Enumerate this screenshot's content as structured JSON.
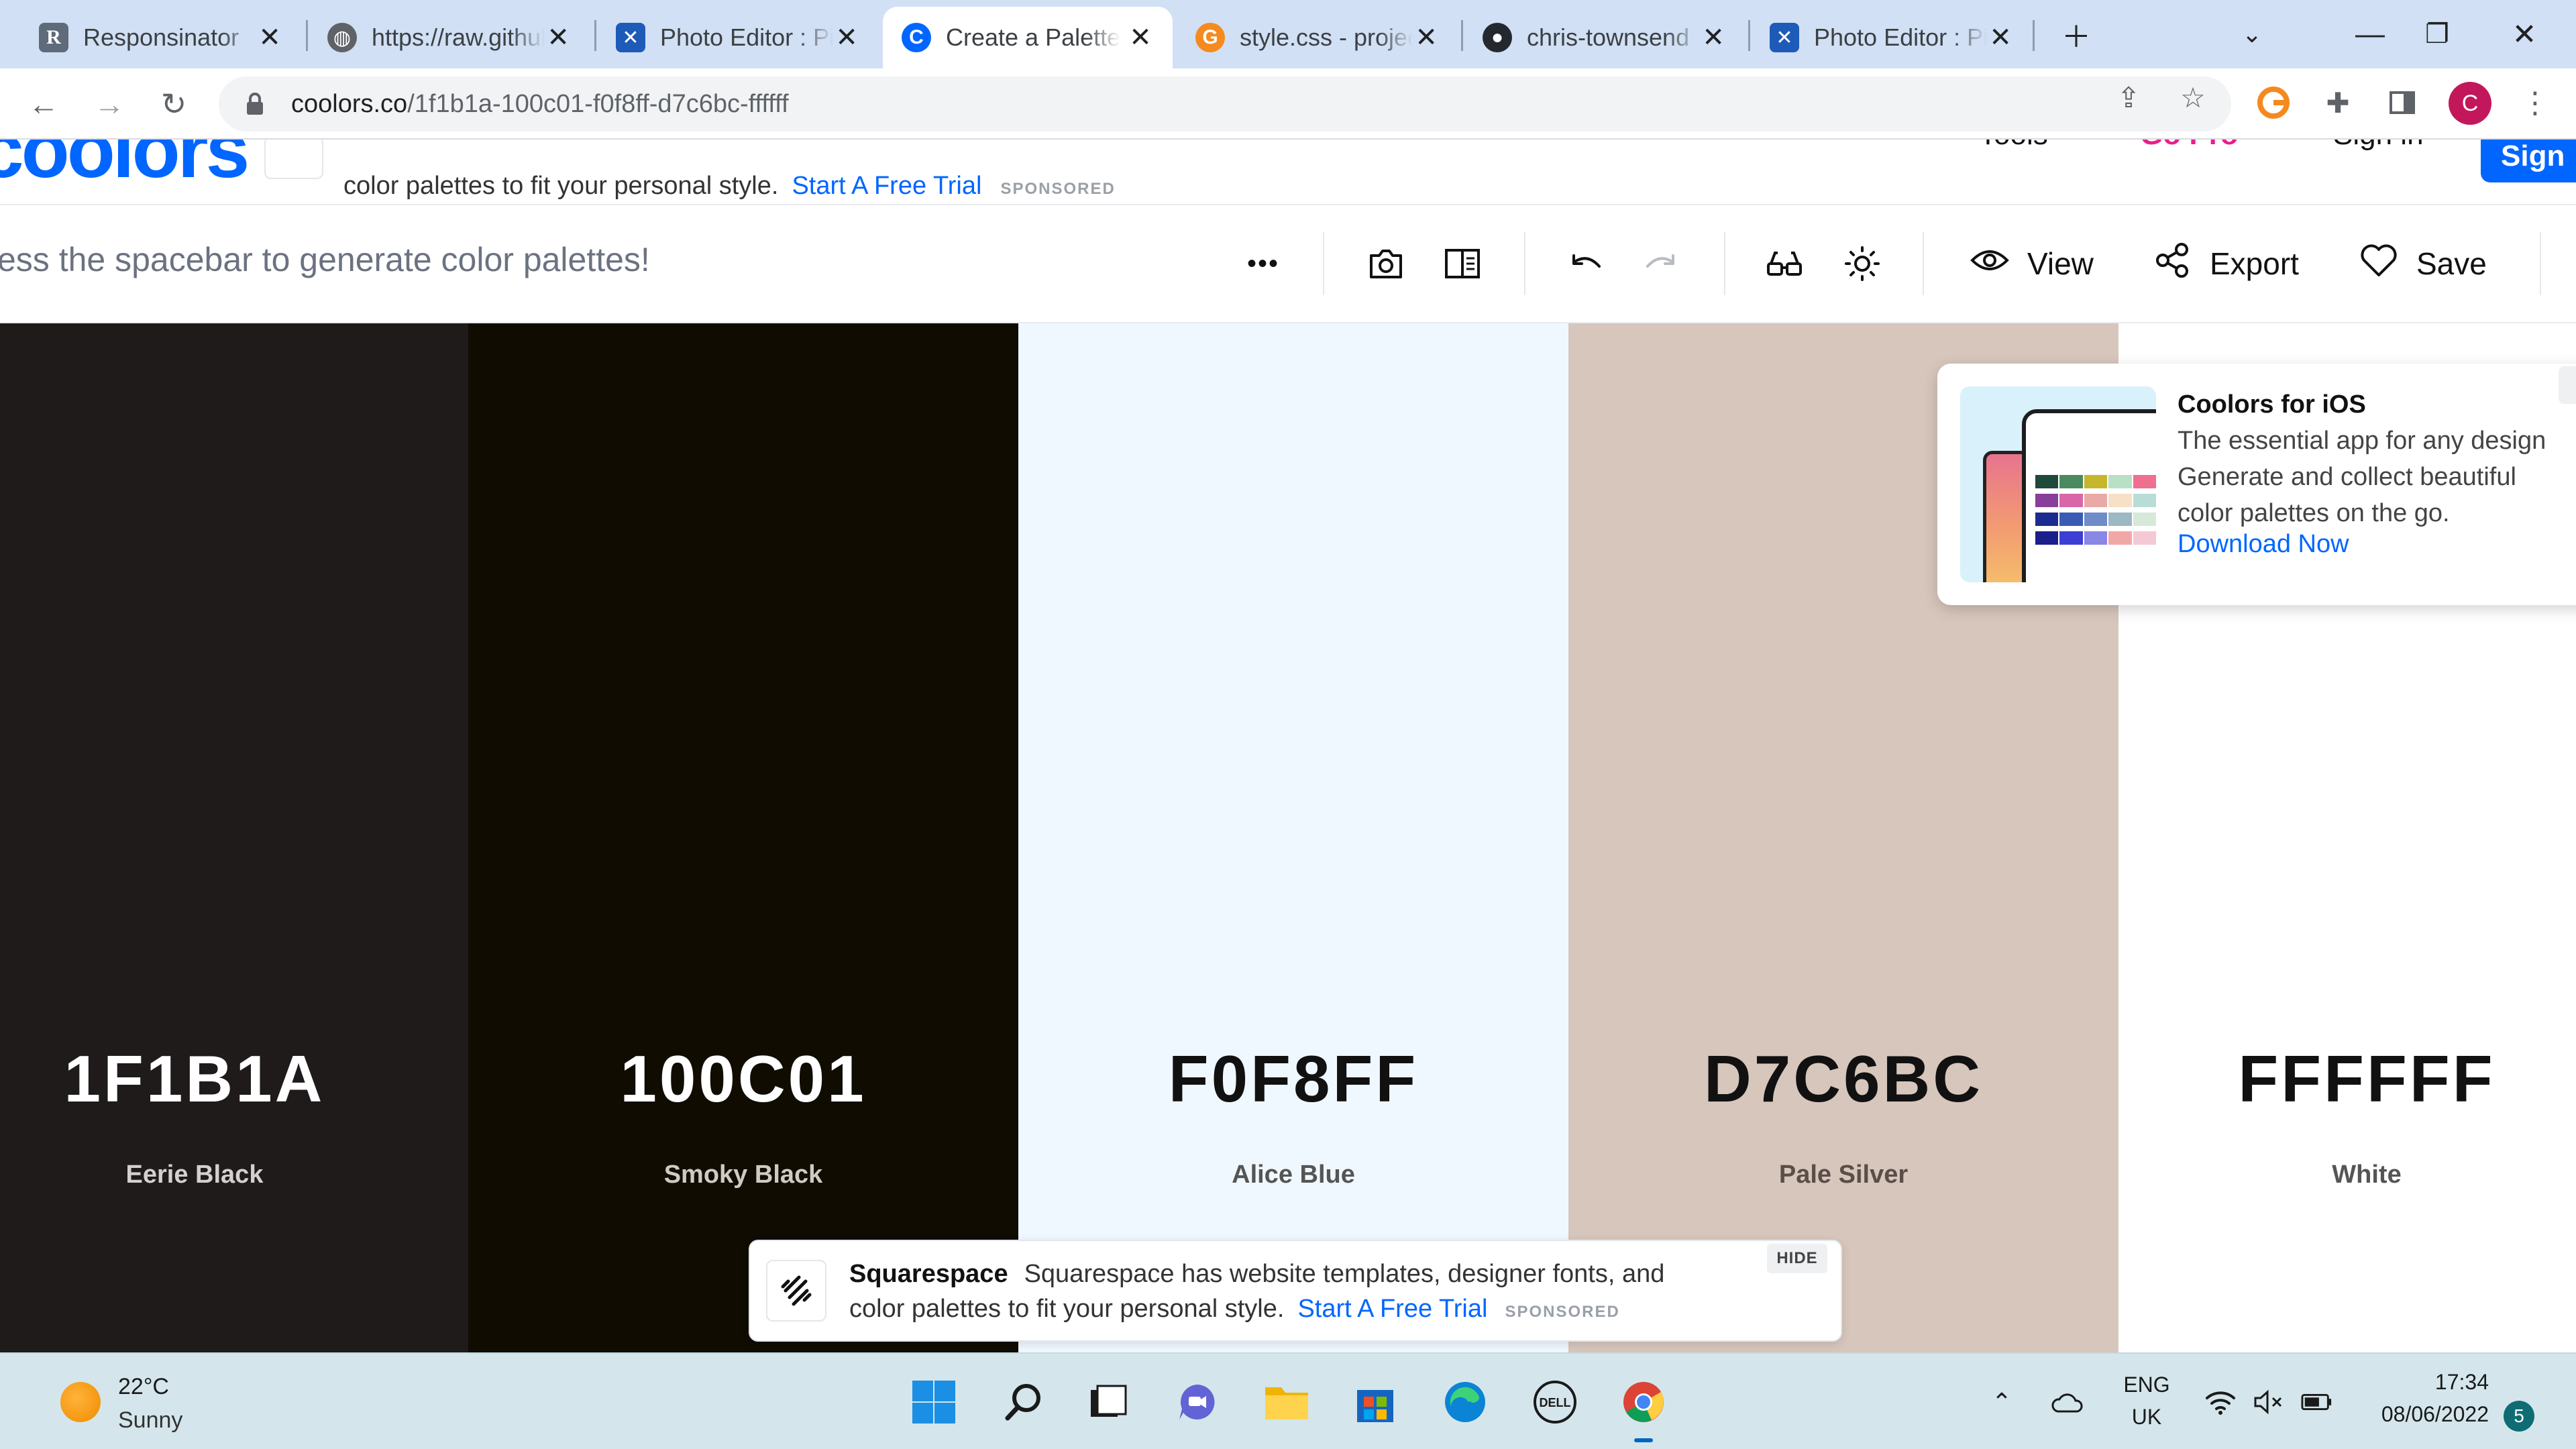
{
  "browser": {
    "tabs": [
      {
        "title": "Responsinator",
        "favicon": "r-favicon"
      },
      {
        "title": "https://raw.githubusercontent",
        "favicon": "globe-favicon"
      },
      {
        "title": "Photo Editor : Pixlr",
        "favicon": "pixlr-favicon"
      },
      {
        "title": "Create a Palette",
        "favicon": "coolors-favicon",
        "active": true
      },
      {
        "title": "style.css - project",
        "favicon": "codepen-favicon"
      },
      {
        "title": "chris-townsend",
        "favicon": "github-favicon"
      },
      {
        "title": "Photo Editor : Pixlr",
        "favicon": "pixlr-favicon"
      }
    ],
    "url_domain": "coolors.co",
    "url_path": "/1f1b1a-100c01-f0f8ff-d7c6bc-ffffff",
    "profile_initial": "C"
  },
  "site_header": {
    "ad_text": "color palettes to fit your personal style.",
    "ad_link": "Start A Free Trial",
    "ad_sponsored": "SPONSORED",
    "tools_label": "Tools",
    "pro_label": "Go Pro",
    "signin_label": "Sign in",
    "signup_label": "Sign up"
  },
  "generator_bar": {
    "hint": "ess the spacebar to generate color palettes!",
    "more": "•••",
    "view_label": "View",
    "export_label": "Export",
    "save_label": "Save"
  },
  "palette": [
    {
      "hex": "1F1B1A",
      "name": "Eerie Black",
      "color": "#1f1b1a",
      "text_color": "#ffffff",
      "name_color": "#d4d0cf"
    },
    {
      "hex": "100C01",
      "name": "Smoky Black",
      "color": "#100c01",
      "text_color": "#ffffff",
      "name_color": "#cfcbc3"
    },
    {
      "hex": "F0F8FF",
      "name": "Alice Blue",
      "color": "#f0f8ff",
      "text_color": "#111111",
      "name_color": "#555555"
    },
    {
      "hex": "D7C6BC",
      "name": "Pale Silver",
      "color": "#d7c6bc",
      "text_color": "#111111",
      "name_color": "#5a4e48"
    },
    {
      "hex": "FFFFFF",
      "name": "White",
      "color": "#ffffff",
      "text_color": "#111111",
      "name_color": "#555555"
    }
  ],
  "ios_promo": {
    "title": "Coolors for iOS",
    "line1": "The essential app for any design",
    "line2": "Generate and collect beautiful",
    "line3": "color palettes on the go.",
    "link": "Download Now"
  },
  "bottom_ad": {
    "brand": "Squarespace",
    "line1": "Squarespace has website templates, designer fonts, and",
    "line2": "color palettes to fit your personal style.",
    "link": "Start A Free Trial",
    "sponsored": "SPONSORED",
    "hide": "HIDE"
  },
  "taskbar": {
    "temperature": "22°C",
    "condition": "Sunny",
    "lang1": "ENG",
    "lang2": "UK",
    "time": "17:34",
    "date": "08/06/2022",
    "notifications": "5"
  }
}
